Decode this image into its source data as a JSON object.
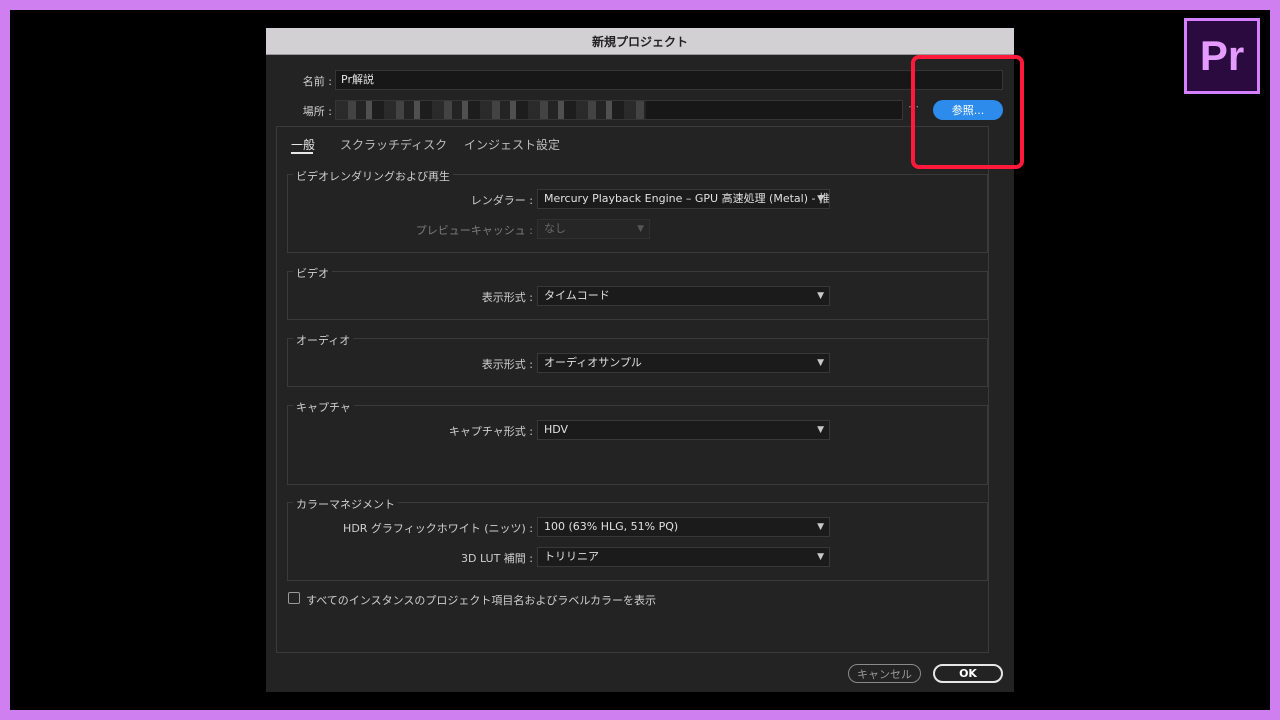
{
  "logo_text": "Pr",
  "dialog": {
    "title": "新規プロジェクト",
    "name_label": "名前 :",
    "name_value": "Pr解説",
    "location_label": "場所 :",
    "location_ellipsis": "⋯",
    "browse_label": "参照..."
  },
  "tabs": [
    {
      "label": "一般",
      "active": true
    },
    {
      "label": "スクラッチディスク",
      "active": false
    },
    {
      "label": "インジェスト設定",
      "active": false
    }
  ],
  "sections": {
    "video_rendering": {
      "title": "ビデオレンダリングおよび再生",
      "renderer_label": "レンダラー :",
      "renderer_value": "Mercury Playback Engine – GPU 高速処理 (Metal) - 推奨",
      "preview_cache_label": "プレビューキャッシュ :",
      "preview_cache_value": "なし"
    },
    "video": {
      "title": "ビデオ",
      "display_format_label": "表示形式 :",
      "display_format_value": "タイムコード"
    },
    "audio": {
      "title": "オーディオ",
      "display_format_label": "表示形式 :",
      "display_format_value": "オーディオサンプル"
    },
    "capture": {
      "title": "キャプチャ",
      "capture_format_label": "キャプチャ形式 :",
      "capture_format_value": "HDV"
    },
    "color_management": {
      "title": "カラーマネジメント",
      "hdr_label": "HDR グラフィックホワイト (ニッツ) :",
      "hdr_value": "100 (63% HLG, 51% PQ)",
      "lut_label": "3D LUT 補間 :",
      "lut_value": "トリリニア"
    }
  },
  "checkbox_label": "すべてのインスタンスのプロジェクト項目名およびラベルカラーを表示",
  "buttons": {
    "cancel": "キャンセル",
    "ok": "OK"
  },
  "colors": {
    "accent": "#2d8ceb",
    "highlight": "#ff1a3c",
    "frame": "#cf7ff0"
  }
}
